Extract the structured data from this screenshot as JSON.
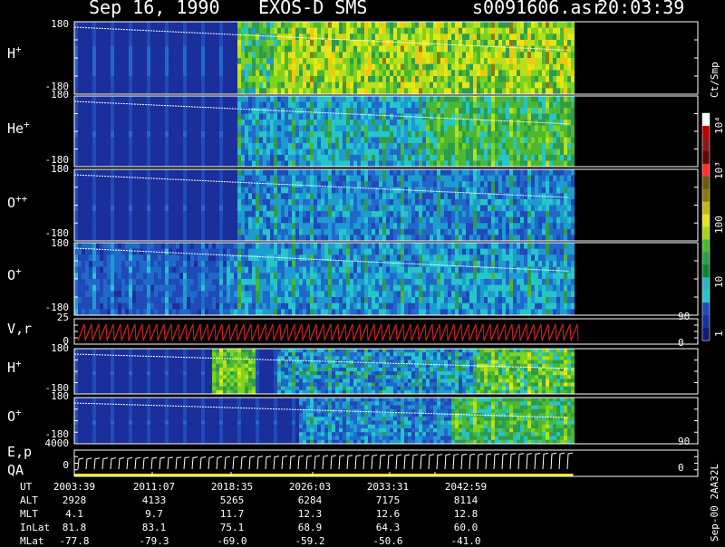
{
  "header": {
    "date": "Sep 16, 1990",
    "instrument": "EXOS-D SMS",
    "filename": "s0091606.asr",
    "time": "20:03:39"
  },
  "side_labels": {
    "units": "Ct/Smp",
    "file_code": "Sep-00 2AA32L"
  },
  "colorbar": {
    "ticks": [
      "1",
      "10",
      "100",
      "10³",
      "10⁴"
    ]
  },
  "panels": [
    {
      "label": "H",
      "charge": "+",
      "ymax": "180",
      "ymin": "-180"
    },
    {
      "label": "He",
      "charge": "+",
      "ymax": "180",
      "ymin": "-180"
    },
    {
      "label": "O",
      "charge": "++",
      "ymax": "180",
      "ymin": "-180"
    },
    {
      "label": "O",
      "charge": "+",
      "ymax": "180",
      "ymin": "-180"
    },
    {
      "label": "V,r",
      "charge": "",
      "ymax": "25",
      "ymin": "0",
      "rmax": "90",
      "rmin": "0"
    },
    {
      "label": "H",
      "charge": "+",
      "ymax": "180",
      "ymin": "-180"
    },
    {
      "label": "O",
      "charge": "+",
      "ymax": "180",
      "ymin": "-180"
    },
    {
      "label": "E,p",
      "label2": "QA",
      "charge": "",
      "ymax": "4000",
      "ymin": "0",
      "rmax": "90",
      "rmin": "0"
    }
  ],
  "chart_data": {
    "type": "heatmap",
    "x_label": "UT",
    "x_ticks": [
      "2003:39",
      "2011:07",
      "2018:35",
      "2026:03",
      "2033:31",
      "2042:59"
    ],
    "ephemeris": [
      {
        "name": "ALT",
        "values": [
          "2928",
          "4133",
          "5265",
          "6284",
          "7175",
          "8114"
        ]
      },
      {
        "name": "MLT",
        "values": [
          "4.1",
          "9.7",
          "11.7",
          "12.3",
          "12.6",
          "12.8"
        ]
      },
      {
        "name": "InLat",
        "values": [
          "81.8",
          "83.1",
          "75.1",
          "68.9",
          "64.3",
          "60.0"
        ]
      },
      {
        "name": "MLat",
        "values": [
          "-77.8",
          "-79.3",
          "-69.0",
          "-59.2",
          "-50.6",
          "-41.0"
        ]
      }
    ],
    "colorbar_range": [
      1,
      10000
    ],
    "colorbar_scale": "log",
    "data_coverage": [
      0.0,
      0.8
    ]
  }
}
